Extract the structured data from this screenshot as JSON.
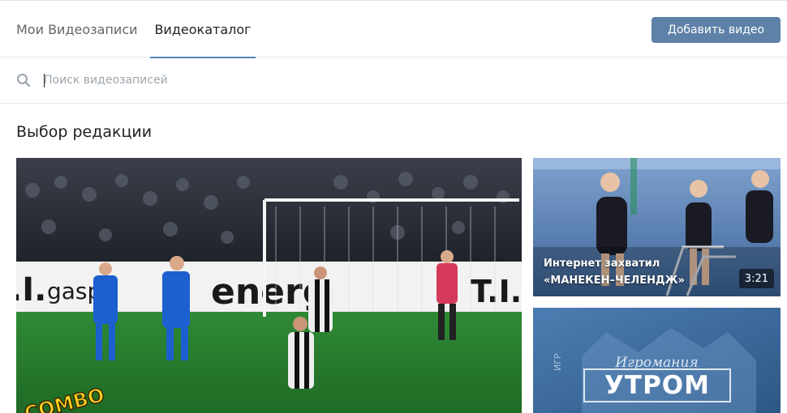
{
  "tabs": [
    {
      "label": "Мои Видеозаписи",
      "active": false
    },
    {
      "label": "Видеокаталог",
      "active": true
    }
  ],
  "add_video_button": "Добавить видео",
  "search": {
    "placeholder": "Поиск видеозаписей",
    "icon": "search-icon"
  },
  "section_title": "Выбор редакции",
  "videos": [
    {
      "caption": "",
      "duration": "",
      "overlay_text": "COMBO"
    },
    {
      "caption": "Интернет захватил «МАНЕКЕН–ЧЕЛЕНДЖ»",
      "duration": "3:21"
    },
    {
      "caption": "",
      "duration": "",
      "brand_small": "Игромания",
      "brand_large": "УТРОМ"
    }
  ],
  "colors": {
    "accent": "#5181b8",
    "button": "#5e81a8"
  }
}
